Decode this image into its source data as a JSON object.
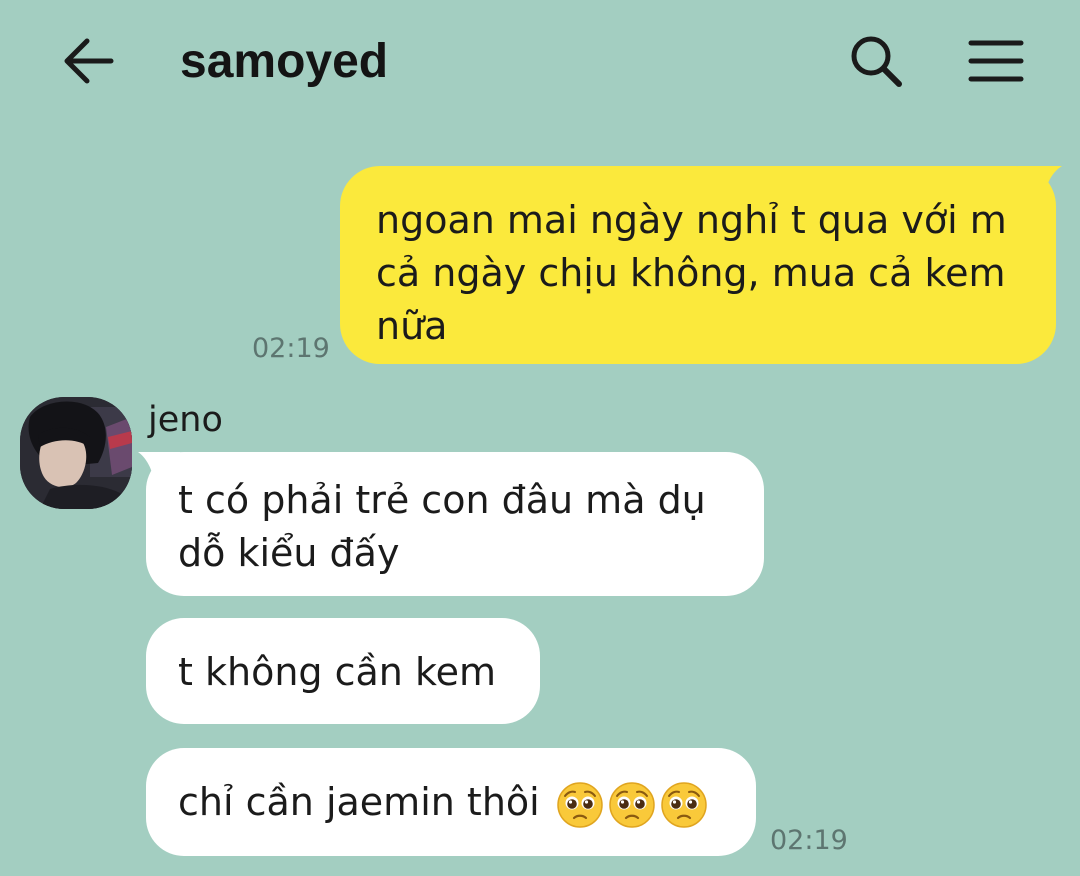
{
  "header": {
    "title": "samoyed",
    "back_icon": "arrow-left-icon",
    "search_icon": "search-icon",
    "menu_icon": "hamburger-menu-icon"
  },
  "messages": [
    {
      "direction": "outgoing",
      "lines": [
        "ngoan mai ngày nghỉ t qua với m",
        "cả ngày chịu không, mua cả kem",
        "nữa"
      ],
      "time": "02:19"
    },
    {
      "direction": "incoming",
      "sender": "jeno",
      "lines": [
        "t có phải trẻ con đâu mà dụ",
        "dỗ kiểu đấy"
      ]
    },
    {
      "direction": "incoming",
      "lines": [
        "t không cần kem"
      ]
    },
    {
      "direction": "incoming",
      "lines": [
        "chỉ cần jaemin thôi"
      ],
      "emoji": [
        "pleading-face-emoji",
        "pleading-face-emoji",
        "pleading-face-emoji"
      ],
      "time": "02:19"
    }
  ],
  "colors": {
    "background": "#a3cec1",
    "outgoing_bubble": "#fbe93c",
    "incoming_bubble": "#ffffff",
    "timestamp": "#5d7570"
  }
}
